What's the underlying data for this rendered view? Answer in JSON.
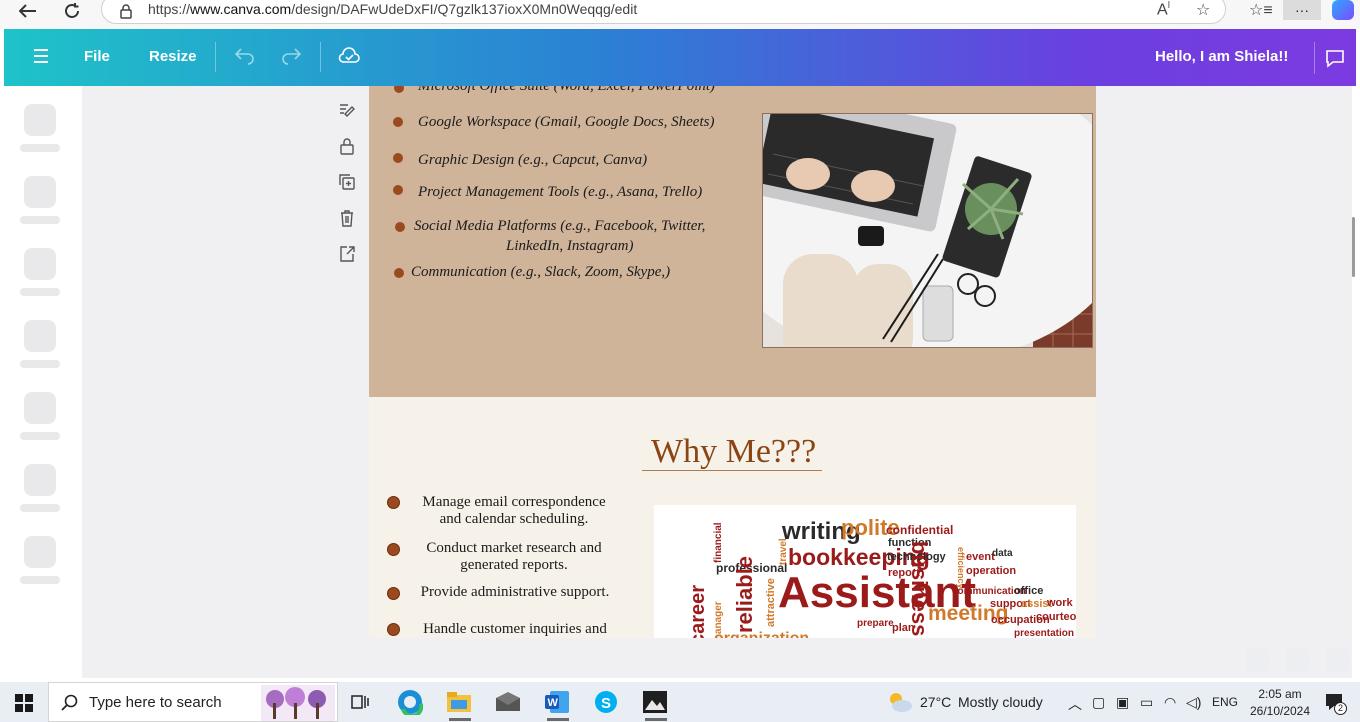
{
  "browser": {
    "url_prefix": "https://",
    "url_host": "www.canva.com",
    "url_path": "/design/DAFwUdeDxFI/Q7gzlk137ioxX0Mn0Weqqg/edit",
    "more_label": "···"
  },
  "header": {
    "file_label": "File",
    "resize_label": "Resize",
    "greeting": "Hello, I am Shiela!!"
  },
  "skills": [
    "Microsoft Office Suite (Word, Excel, PowerPoint)",
    "Google Workspace (Gmail, Google Docs, Sheets)",
    "Graphic Design (e.g., Capcut, Canva)",
    "Project Management Tools (e.g., Asana, Trello)",
    "Social Media Platforms (e.g., Facebook, Twitter,",
    "LinkedIn, Instagram)",
    "Communication (e.g., Slack, Zoom, Skype,)"
  ],
  "why": {
    "title": "Why Me???",
    "items": [
      [
        "Manage email correspondence",
        "and calendar scheduling."
      ],
      [
        "Conduct market research and",
        "generated reports."
      ],
      [
        "Provide administrative support."
      ],
      [
        "Handle customer inquiries and"
      ]
    ]
  },
  "wordcloud": {
    "words": [
      "writing",
      "polite",
      "confidential",
      "function",
      "bookkeeping",
      "technology",
      "report",
      "business",
      "event",
      "data",
      "efficiency",
      "operation",
      "professional",
      "financial",
      "travel",
      "reliable",
      "attractive",
      "Assistant",
      "communication",
      "office",
      "support",
      "assist",
      "work",
      "meeting",
      "occupation",
      "courteous",
      "career",
      "manager",
      "prepare",
      "plan",
      "presentation",
      "organization"
    ]
  },
  "taskbar": {
    "search_placeholder": "Type here to search",
    "temperature": "27°C",
    "weather": "Mostly cloudy",
    "language": "ENG",
    "time": "2:05 am",
    "date": "26/10/2024",
    "notification_count": "2"
  }
}
